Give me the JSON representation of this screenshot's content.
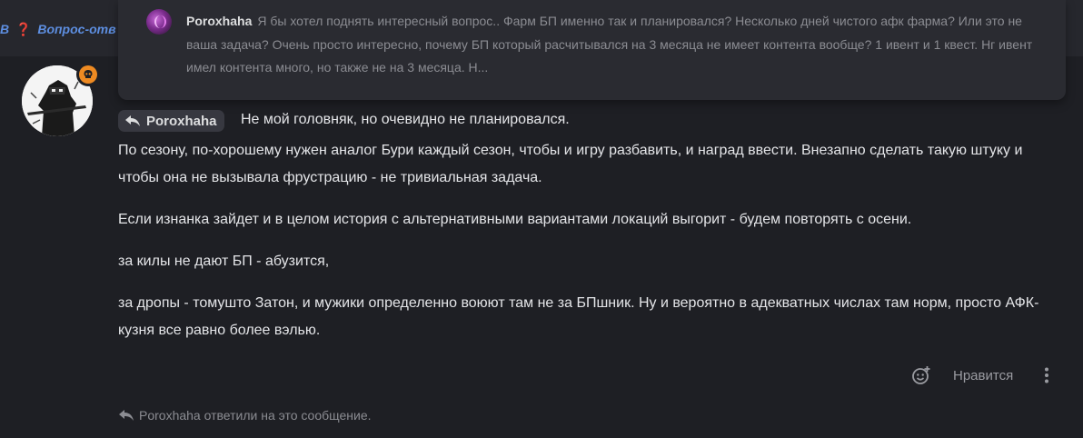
{
  "breadcrumb": {
    "prefix": "В",
    "icon": "question-mark-icon",
    "title": "Вопрос-отв"
  },
  "quoted_message": {
    "author": "Poroxhaha",
    "text": "Я бы хотел поднять интересный вопрос.. Фарм БП именно так и планировался? Несколько дней чистого афк фарма? Или это не ваша задача? Очень просто интересно, почему БП который расчитывался на 3 месяца не имеет контента вообще? 1 ивент и 1 квест. Нг ивент имел контента много, но также не на 3 месяца. Н..."
  },
  "message": {
    "badge_icon": "skull-icon",
    "badge_color": "#ee8a22",
    "reply_to": "Poroxhaha",
    "first_line": "Не мой головняк, но очевидно не планировался.",
    "paragraphs": [
      "По сезону, по-хорошему нужен аналог Бури каждый сезон, чтобы и игру разбавить, и наград ввести. Внезапно сделать такую штуку и чтобы она не вызывала фрустрацию - не тривиальная задача.",
      "Если изнанка зайдет и в целом история с альтернативными вариантами локаций выгорит - будем повторять с осени.",
      "за килы не дают БП - абузится,",
      "за дропы - томушто Затон, и мужики определенно воюют там не за БПшник. Ну и вероятно в адекватных числах там норм, просто АФК-кузня все равно более вэлью."
    ]
  },
  "actions": {
    "emoji_icon": "add-reaction-icon",
    "like_label": "Нравится",
    "more_icon": "more-vertical-icon"
  },
  "replies_note": {
    "icon": "reply-arrow-icon",
    "text": "Poroxhaha ответили на это сообщение."
  }
}
